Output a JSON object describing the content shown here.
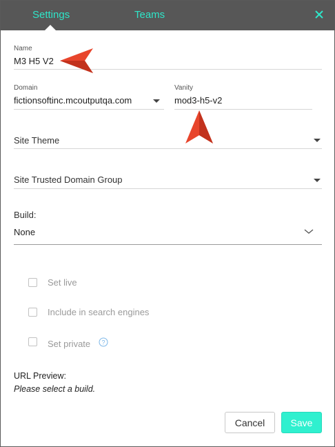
{
  "header": {
    "tabs": [
      {
        "label": "Settings",
        "active": true
      },
      {
        "label": "Teams",
        "active": false
      }
    ],
    "accent_color": "#2ee6c9",
    "background_color": "#575757",
    "close_icon": "close-icon"
  },
  "form": {
    "name": {
      "label": "Name",
      "value": "M3 H5 V2"
    },
    "domain": {
      "label": "Domain",
      "value": "fictionsoftinc.mcoutputqa.com"
    },
    "vanity": {
      "label": "Vanity",
      "value": "mod3-h5-v2"
    },
    "site_theme": {
      "label": "Site Theme",
      "value": ""
    },
    "site_trusted_domain_group": {
      "label": "Site Trusted Domain Group",
      "value": ""
    },
    "build": {
      "label": "Build:",
      "value": "None"
    },
    "checkboxes": [
      {
        "label": "Set live",
        "checked": false
      },
      {
        "label": "Include in search engines",
        "checked": false
      },
      {
        "label": "Set private",
        "checked": false
      }
    ],
    "url_preview": {
      "label": "URL Preview:",
      "value": "Please select a build."
    }
  },
  "annotations": {
    "arrow_color": "#e8452c",
    "icon": "red-arrow-pointer"
  },
  "footer": {
    "cancel_label": "Cancel",
    "save_label": "Save",
    "save_color": "#2ff0cf"
  }
}
